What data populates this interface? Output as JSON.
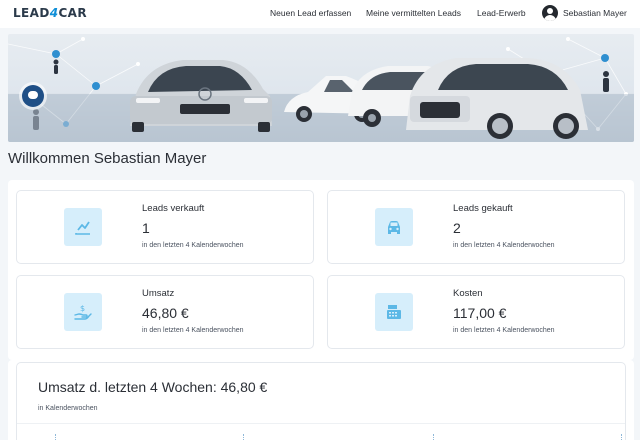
{
  "navbar": {
    "logo_pre": "LEAD",
    "logo_four": "4",
    "logo_post": "CAR",
    "links": [
      "Neuen Lead erfassen",
      "Meine vermittelten Leads",
      "Lead-Erwerb"
    ],
    "user_name": "Sebastian Mayer"
  },
  "welcome": "Willkommen Sebastian Mayer",
  "stats": [
    {
      "label": "Leads verkauft",
      "value": "1",
      "note": "in den letzten 4 Kalenderwochen",
      "icon": "chart-line-icon"
    },
    {
      "label": "Leads gekauft",
      "value": "2",
      "note": "in den letzten 4 Kalenderwochen",
      "icon": "car-icon"
    },
    {
      "label": "Umsatz",
      "value": "46,80 €",
      "note": "in den letzten 4 Kalenderwochen",
      "icon": "money-hand-icon"
    },
    {
      "label": "Kosten",
      "value": "117,00 €",
      "note": "in den letzten 4 Kalenderwochen",
      "icon": "cash-register-icon"
    }
  ],
  "revenue": {
    "title": "Umsatz d. letzten 4 Wochen: 46,80 €",
    "subtitle": "in Kalenderwochen"
  },
  "colors": {
    "accent": "#0f8fd8",
    "icon_bg": "#d6eefb",
    "icon_fg": "#5cb8e6"
  }
}
